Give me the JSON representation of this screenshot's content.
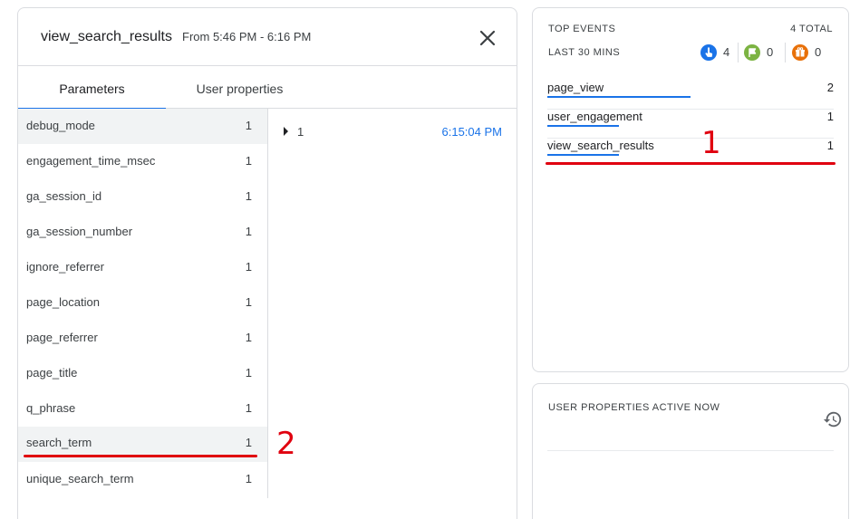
{
  "event_panel": {
    "title": "view_search_results",
    "time_range": "From 5:46 PM - 6:16 PM",
    "tabs": [
      {
        "label": "Parameters",
        "active": true
      },
      {
        "label": "User properties",
        "active": false
      }
    ],
    "parameters": [
      {
        "name": "debug_mode",
        "count": "1"
      },
      {
        "name": "engagement_time_msec",
        "count": "1"
      },
      {
        "name": "ga_session_id",
        "count": "1"
      },
      {
        "name": "ga_session_number",
        "count": "1"
      },
      {
        "name": "ignore_referrer",
        "count": "1"
      },
      {
        "name": "page_location",
        "count": "1"
      },
      {
        "name": "page_referrer",
        "count": "1"
      },
      {
        "name": "page_title",
        "count": "1"
      },
      {
        "name": "q_phrase",
        "count": "1"
      },
      {
        "name": "search_term",
        "count": "1"
      },
      {
        "name": "unique_search_term",
        "count": "1"
      }
    ],
    "value": {
      "text": "1",
      "time": "6:15:04 PM"
    }
  },
  "top_events": {
    "title": "TOP EVENTS",
    "total": "4 TOTAL",
    "range": "LAST 30 MINS",
    "counters": [
      {
        "icon": "touch-icon",
        "color": "#1a73e8",
        "value": "4"
      },
      {
        "icon": "flag-icon",
        "color": "#7cb342",
        "value": "0"
      },
      {
        "icon": "gift-icon",
        "color": "#e8710a",
        "value": "0"
      }
    ],
    "events": [
      {
        "name": "page_view",
        "count": "2",
        "share": 0.5
      },
      {
        "name": "user_engagement",
        "count": "1",
        "share": 0.25
      },
      {
        "name": "view_search_results",
        "count": "1",
        "share": 0.25
      }
    ]
  },
  "user_properties": {
    "title": "USER PROPERTIES ACTIVE NOW"
  },
  "annotations": [
    "1",
    "2"
  ],
  "colors": {
    "accent": "#1a73e8",
    "annotation": "#e0000f",
    "selected_row": "#f1f3f4"
  }
}
